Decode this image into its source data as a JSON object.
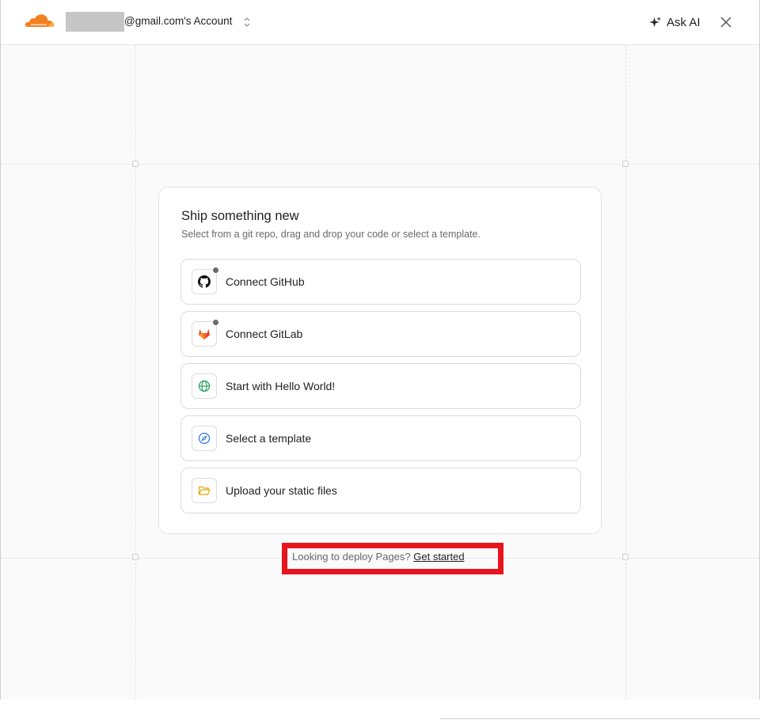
{
  "header": {
    "account_label": "@gmail.com's Account",
    "ask_ai_label": "Ask AI",
    "close_icon": "close-icon",
    "brand_color": "#f38020"
  },
  "card": {
    "title": "Ship something new",
    "subtitle": "Select from a git repo, drag and drop your code or select a template.",
    "options": [
      {
        "label": "Connect GitHub",
        "icon": "github-icon",
        "status_dot": true
      },
      {
        "label": "Connect GitLab",
        "icon": "gitlab-icon",
        "status_dot": true
      },
      {
        "label": "Start with Hello World!",
        "icon": "globe-icon",
        "status_dot": false
      },
      {
        "label": "Select a template",
        "icon": "compass-icon",
        "status_dot": false
      },
      {
        "label": "Upload your static files",
        "icon": "folder-icon",
        "status_dot": false
      }
    ]
  },
  "footer": {
    "pages_prompt": "Looking to deploy Pages?",
    "get_started_link": "Get started",
    "highlight_color": "#e8141e"
  }
}
